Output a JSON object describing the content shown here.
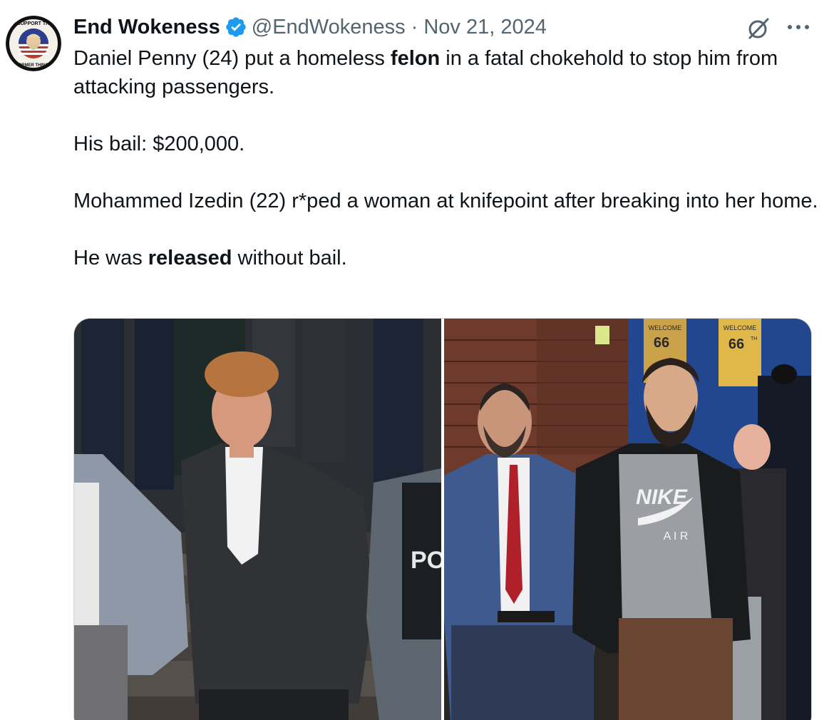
{
  "author": {
    "display_name": "End Wokeness",
    "handle": "@EndWokeness",
    "separator": "·",
    "date": "Nov 21, 2024",
    "avatar_icon": "profile-badge-avatar",
    "avatar_text_top": "I SUPPORT THE",
    "avatar_text_bottom": "FORMER THINGS",
    "verified_color": "#1d9bf0"
  },
  "actions": {
    "grok_icon": "grok-icon",
    "more_icon": "more-horizontal-icon"
  },
  "tweet": {
    "para1_pre": "Daniel Penny (24) put a homeless ",
    "para1_bold": "felon",
    "para1_post": " in a fatal chokehold to stop him from attacking passengers.",
    "para2": "His bail: $200,000.",
    "para3": "Mohammed Izedin (22) r*ped a woman at knifepoint after breaking into her home.",
    "para4_pre": "He was ",
    "para4_bold": "released",
    "para4_post": " without bail."
  },
  "media": {
    "left_signage": "POL",
    "right_sign1_line1": "WELCOME",
    "right_sign1_line2": "66",
    "right_sign2_line1": "WELCOME",
    "right_sign2_line2": "66",
    "right_sign2_sup": "TH",
    "shirt_brand": "NIKE",
    "shirt_sub": "A I R"
  }
}
